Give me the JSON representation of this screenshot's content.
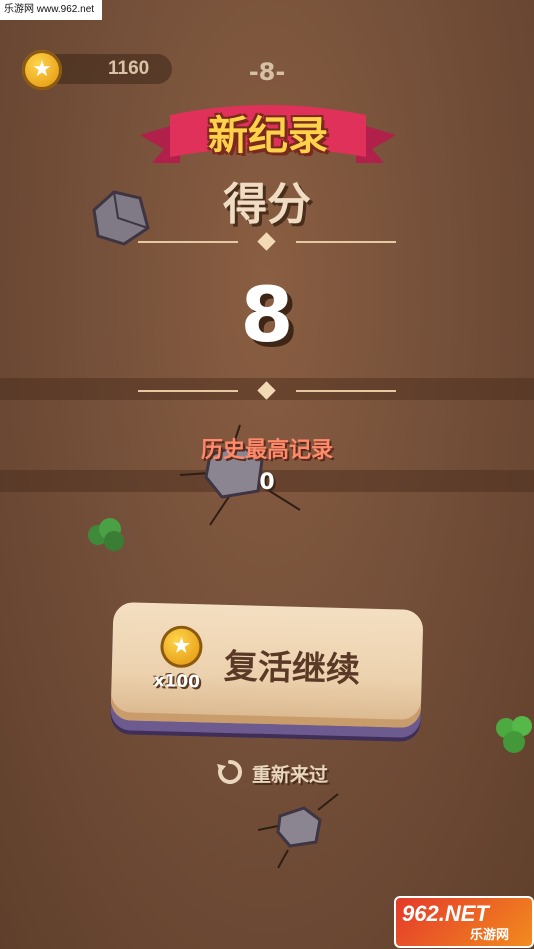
{
  "watermark_top": "乐游网 www.962.net",
  "coins": {
    "value": "1160",
    "icon": "star-coin-icon"
  },
  "level": "-8-",
  "banner": {
    "title": "新纪录"
  },
  "score": {
    "label": "得分",
    "value": "8"
  },
  "best": {
    "label": "历史最高记录",
    "value": "0"
  },
  "revive": {
    "cost": "x100",
    "label": "复活继续",
    "icon": "star-coin-icon"
  },
  "restart": {
    "label": "重新来过",
    "icon": "restart-icon"
  },
  "watermark_bottom": {
    "main": "962.NET",
    "sub": "乐游网"
  },
  "colors": {
    "background": "#6f4b33",
    "ribbon": "#e0315a",
    "banner_text": "#ffd24a",
    "best_label": "#ff8a6b",
    "button": "#f4dfc2",
    "button_shadow": "#6d5a8f"
  }
}
